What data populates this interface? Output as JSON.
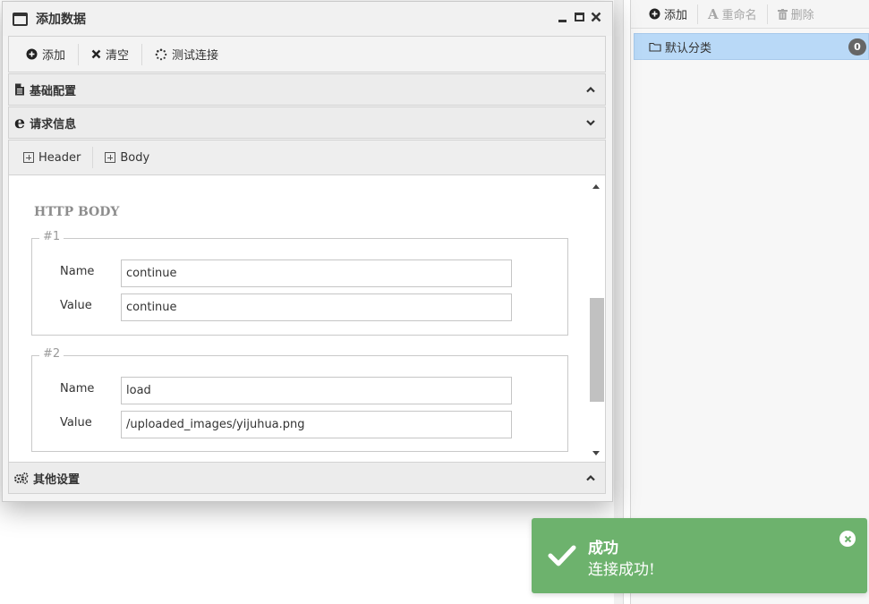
{
  "dialog": {
    "title": "添加数据",
    "toolbar": {
      "add_label": "添加",
      "clear_label": "清空",
      "test_label": "测试连接"
    },
    "sections": {
      "basic": "基础配置",
      "request": "请求信息",
      "other": "其他设置"
    },
    "tabs": {
      "header": "Header",
      "body": "Body"
    },
    "http_body": {
      "title": "HTTP BODY",
      "params": [
        {
          "legend": "#1",
          "name_label": "Name",
          "name": "continue",
          "value_label": "Value",
          "value": "continue"
        },
        {
          "legend": "#2",
          "name_label": "Name",
          "name": "load",
          "value_label": "Value",
          "value": "/uploaded_images/yijuhua.png"
        }
      ]
    }
  },
  "right_panel": {
    "toolbar": {
      "add_label": "添加",
      "rename_label": "重命名",
      "delete_label": "删除"
    },
    "category": {
      "label": "默认分类",
      "count": "0"
    }
  },
  "toast": {
    "title": "成功",
    "message": "连接成功!",
    "color": "#6db26d"
  }
}
